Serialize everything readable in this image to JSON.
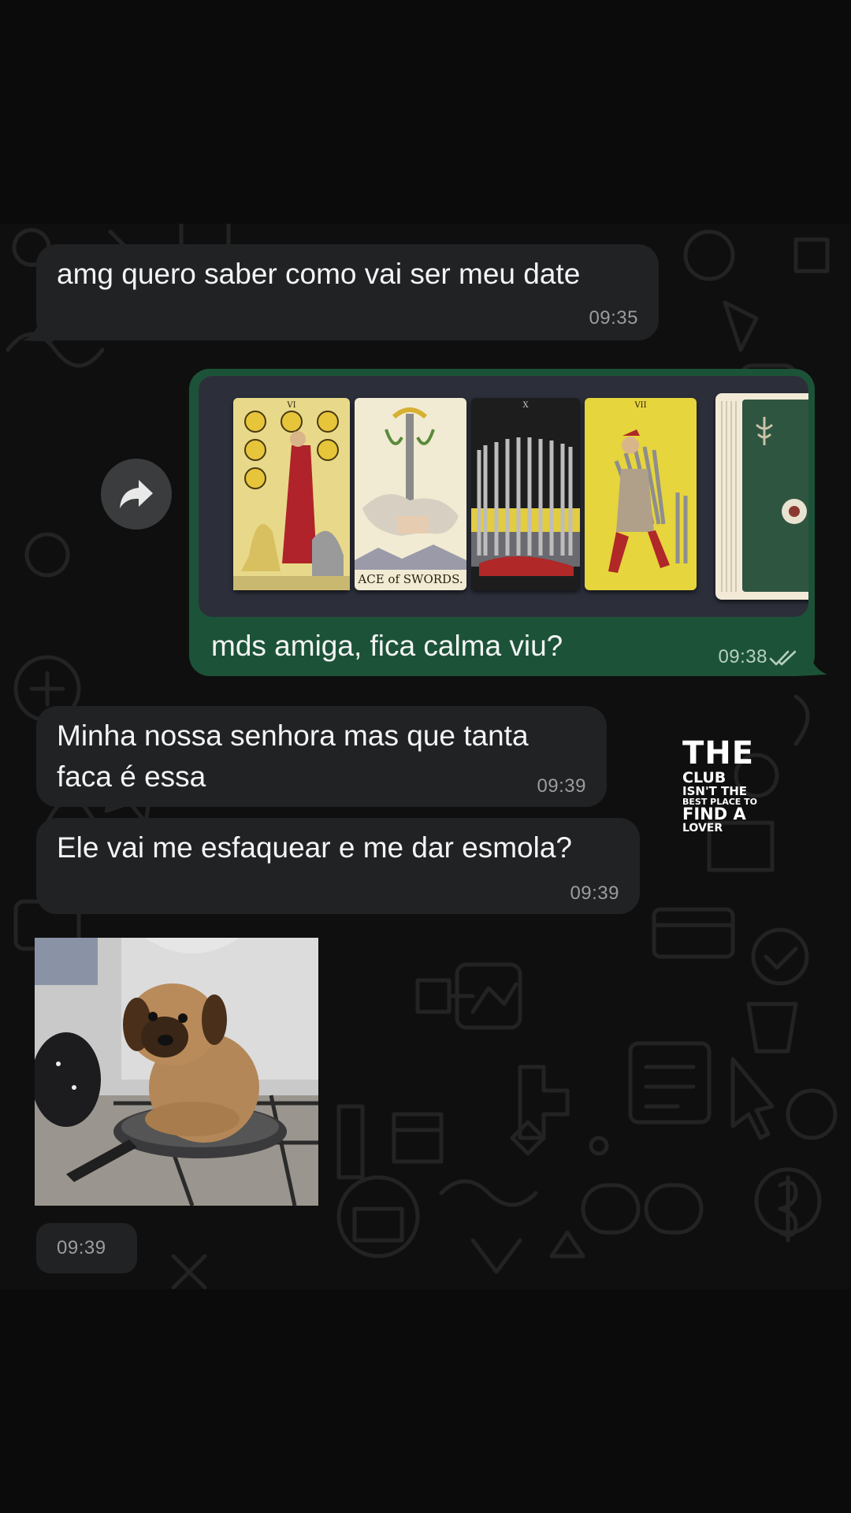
{
  "messages": [
    {
      "direction": "incoming",
      "text": "amg quero saber como vai ser meu date",
      "time": "09:35"
    },
    {
      "direction": "outgoing",
      "caption": "mds amiga, fica calma viu?",
      "time": "09:38",
      "status": "read",
      "image": {
        "cards": [
          {
            "number": "VI"
          },
          {
            "label": "ACE of SWORDS."
          },
          {
            "number": "X"
          },
          {
            "number": "VII"
          },
          {}
        ]
      }
    },
    {
      "direction": "incoming",
      "text": "Minha nossa senhora mas que tanta\nfaca é essa",
      "time": "09:39"
    },
    {
      "direction": "incoming",
      "text": "Ele vai me esfaquear e me dar esmola?",
      "time": "09:39"
    },
    {
      "direction": "incoming",
      "time": "09:39"
    }
  ],
  "watermark": {
    "line1": "THE",
    "line2": "CLUB",
    "line3": "ISN'T THE",
    "line4": "BEST PLACE TO",
    "line5": "FIND A",
    "line6": "LOVER"
  },
  "icons": {
    "forward": "forward-arrow-icon",
    "read_receipt": "double-check-icon"
  },
  "colors": {
    "incoming_bubble": "#202224",
    "outgoing_bubble": "#1c5338",
    "background": "#0b0b0b"
  }
}
